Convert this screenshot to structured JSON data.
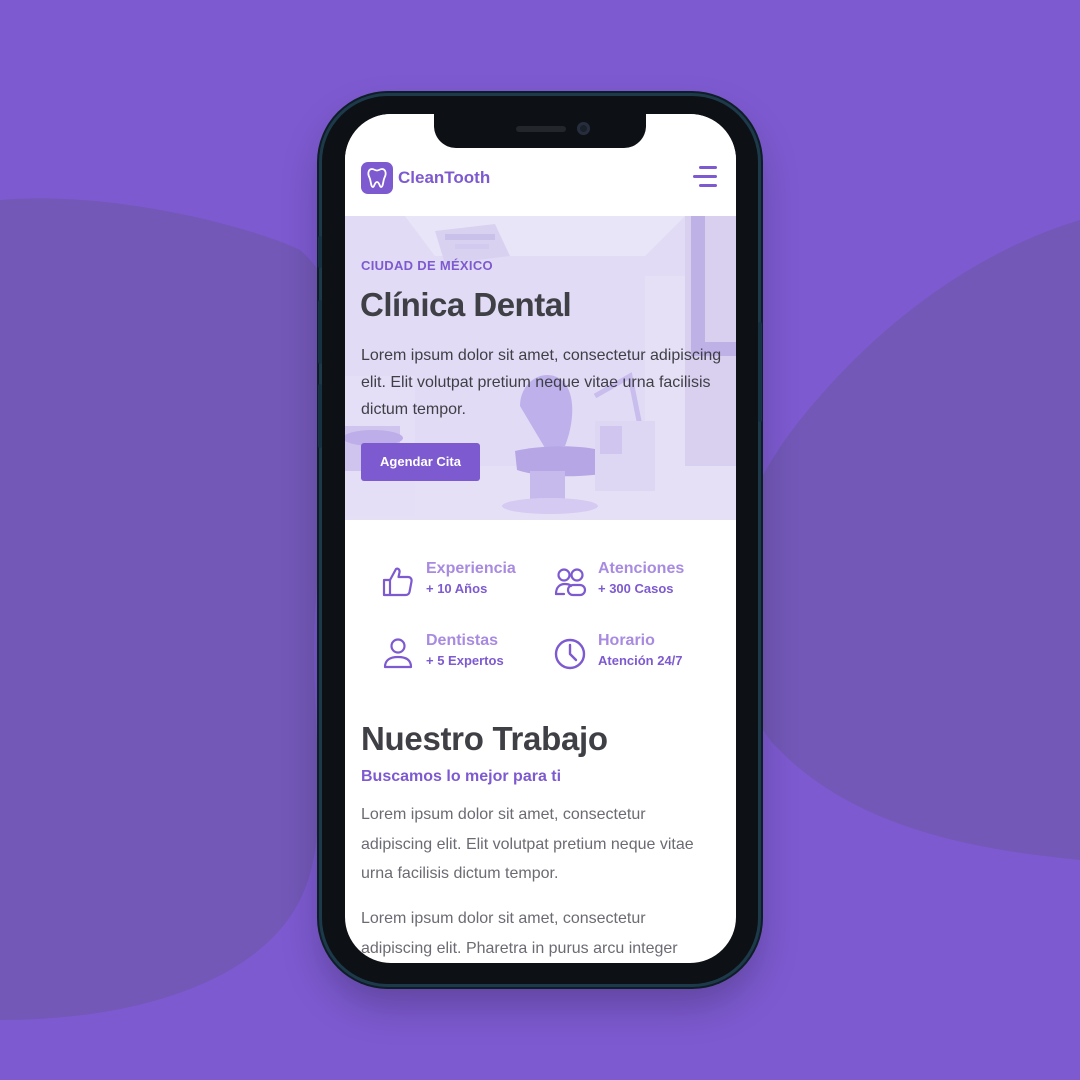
{
  "colors": {
    "background": "#7d5ad0",
    "accent": "#7d5ad0",
    "accent_light": "#a88be0",
    "text_dark": "#3f3f46",
    "text_muted": "#6b6b73"
  },
  "header": {
    "logo_icon": "tooth-icon",
    "brand": "CleanTooth",
    "menu_icon": "hamburger-menu-icon"
  },
  "hero": {
    "kicker": "CIUDAD DE MÉXICO",
    "title": "Clínica Dental",
    "text": "Lorem ipsum dolor sit amet, consectetur adipiscing elit. Elit volutpat pretium neque vitae urna facilisis dictum tempor.",
    "button": "Agendar Cita"
  },
  "features": [
    {
      "icon": "thumbs-up-icon",
      "title": "Experiencia",
      "subtitle": "+ 10 Años"
    },
    {
      "icon": "users-icon",
      "title": "Atenciones",
      "subtitle": "+ 300 Casos"
    },
    {
      "icon": "user-icon",
      "title": "Dentistas",
      "subtitle": "+ 5 Expertos"
    },
    {
      "icon": "clock-icon",
      "title": "Horario",
      "subtitle": "Atención 24/7"
    }
  ],
  "work": {
    "title": "Nuestro Trabajo",
    "subtitle": "Buscamos lo mejor para ti",
    "paragraph1": "Lorem ipsum dolor sit amet, consectetur adipiscing elit. Elit volutpat pretium neque vitae urna facilisis dictum tempor.",
    "paragraph2": "Lorem ipsum dolor sit amet, consectetur adipiscing elit. Pharetra in purus arcu integer"
  }
}
